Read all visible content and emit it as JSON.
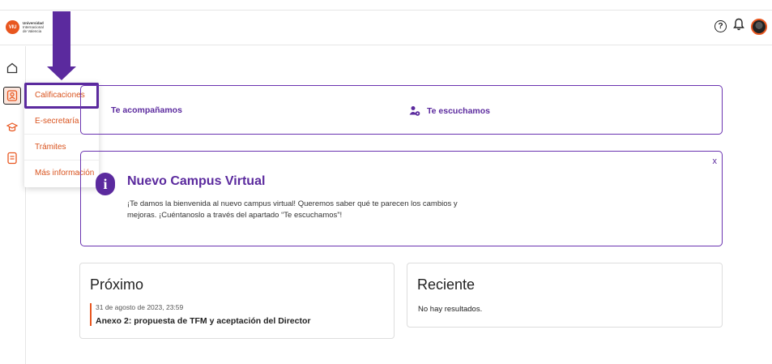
{
  "brand": {
    "logo_mark": "VIU",
    "name_lines": [
      "Universidad",
      "Internacional",
      "de Valencia"
    ]
  },
  "header": {
    "icons": [
      "help-icon",
      "bell-icon",
      "avatar"
    ]
  },
  "sidebar": {
    "icons": [
      "home-icon",
      "user-profile-icon",
      "graduation-cap-icon",
      "document-icon"
    ]
  },
  "menu": {
    "items": [
      {
        "label": "Calificaciones",
        "selected": true
      },
      {
        "label": "E-secretaría"
      },
      {
        "label": "Trámites"
      },
      {
        "label": "Más información"
      }
    ]
  },
  "links_card": {
    "left": "Te acompañamos",
    "right": "Te escuchamos"
  },
  "info_card": {
    "title": "Nuevo Campus Virtual",
    "body": "¡Te damos la bienvenida al nuevo campus virtual! Queremos saber qué te parecen los cambios y mejoras. ¡Cuéntanoslo a través del apartado “Te escuchamos”!",
    "close": "x"
  },
  "next_panel": {
    "title": "Próximo",
    "event_date": "31 de agosto de 2023, 23:59",
    "event_title": "Anexo 2: propuesta de TFM y aceptación del Director"
  },
  "recent_panel": {
    "title": "Reciente",
    "empty_text": "No hay resultados."
  },
  "colors": {
    "accent_orange": "#e8561f",
    "accent_purple": "#5b2a9e"
  }
}
